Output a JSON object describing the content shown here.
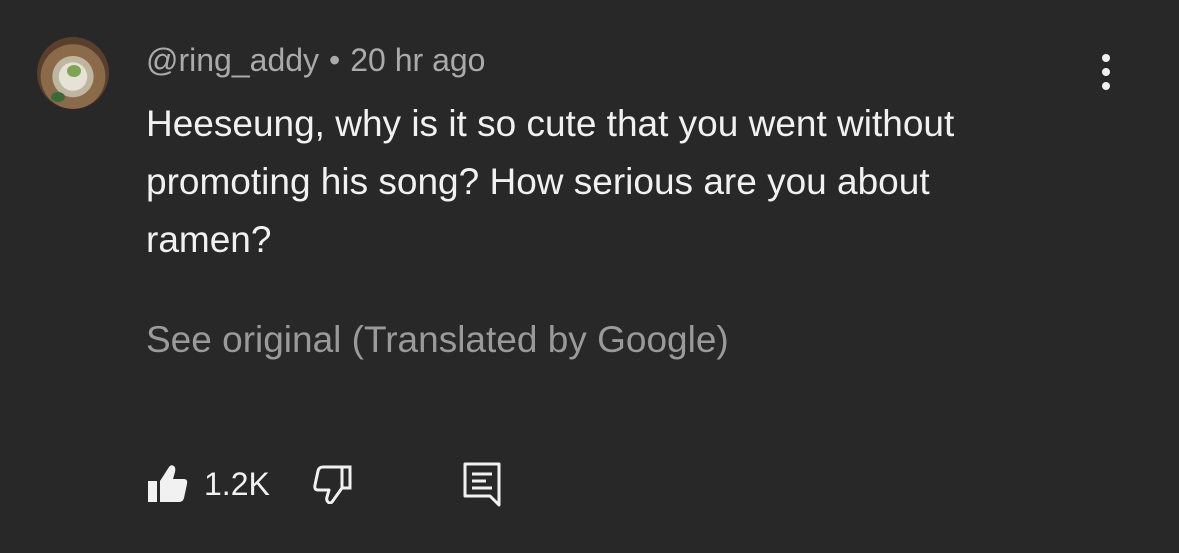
{
  "comment": {
    "username": "@ring_addy",
    "separator": "•",
    "timestamp": "20 hr ago",
    "text": "Heeseung, why is it so cute that you went without promoting his song? How serious are you about ramen?",
    "translate_link": "See original (Translated by Google)"
  },
  "actions": {
    "like_count": "1.2K",
    "like_icon": "thumbs-up-icon",
    "dislike_icon": "thumbs-down-icon",
    "reply_icon": "reply-comment-icon",
    "menu_icon": "more-vertical-icon"
  },
  "colors": {
    "background": "#282828",
    "primary_text": "#f1f1f1",
    "secondary_text": "#aaaaaa"
  }
}
